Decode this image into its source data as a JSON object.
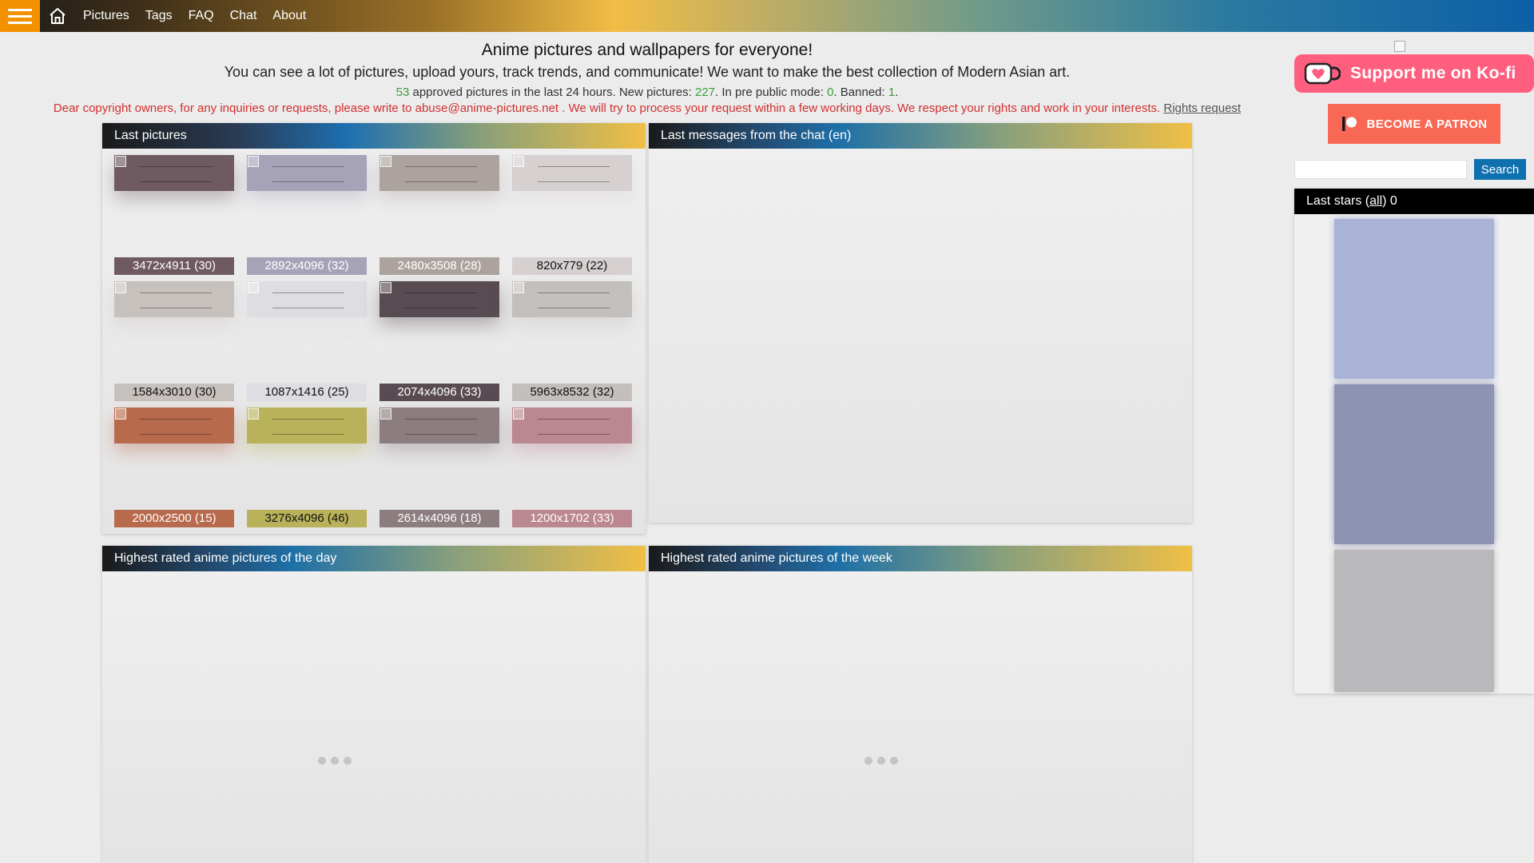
{
  "colors": {
    "accent_orange": "#f39200",
    "stat_green": "#3aa03a",
    "notice_red": "#d23030",
    "kofi_pink": "#ff5e7e",
    "patreon_coral": "#f96854",
    "search_blue": "#0f70b0"
  },
  "topbar": {
    "menu_icon": "hamburger-menu-icon",
    "home_icon": "home-icon",
    "nav": [
      "Pictures",
      "Tags",
      "FAQ",
      "Chat",
      "About"
    ]
  },
  "intro": {
    "title": "Anime pictures and wallpapers for everyone!",
    "subtitle": "You can see a lot of pictures, upload yours, track trends, and communicate! We want to make the best collection of Modern Asian art.",
    "stats": {
      "approved_count": "53",
      "approved_text": " approved pictures in the last 24 hours. New pictures: ",
      "new_count": "227",
      "prepublic_text": ". In pre public mode: ",
      "prepublic_count": "0",
      "banned_text": ". Banned: ",
      "banned_count": "1",
      "end": "."
    },
    "notice": "Dear copyright owners, for any inquiries or requests, please write to abuse@anime-pictures.net . We will try to process your request within a few working days. We respect your rights and work in your interests. ",
    "rights_link": "Rights request"
  },
  "last_pictures": {
    "title": "Last pictures",
    "items": [
      {
        "label": "3472x4911 (30)",
        "color": "#6e5a60",
        "text_color": "#ffffff"
      },
      {
        "label": "2892x4096 (32)",
        "color": "#a6a3b8",
        "text_color": "#ffffff"
      },
      {
        "label": "2480x3508 (28)",
        "color": "#aca39f",
        "text_color": "#ffffff"
      },
      {
        "label": "820x779 (22)",
        "color": "#d6d0d0",
        "text_color": "#111111"
      },
      {
        "label": "1584x3010 (30)",
        "color": "#c7c1bd",
        "text_color": "#111111"
      },
      {
        "label": "1087x1416 (25)",
        "color": "#dedde2",
        "text_color": "#111111"
      },
      {
        "label": "2074x4096 (33)",
        "color": "#584c52",
        "text_color": "#ffffff"
      },
      {
        "label": "5963x8532 (32)",
        "color": "#c3bfbc",
        "text_color": "#111111"
      },
      {
        "label": "2000x2500 (15)",
        "color": "#b86a4d",
        "text_color": "#ffffff"
      },
      {
        "label": "3276x4096 (46)",
        "color": "#b9b25a",
        "text_color": "#111111"
      },
      {
        "label": "2614x4096 (18)",
        "color": "#8c7e80",
        "text_color": "#ffffff"
      },
      {
        "label": "1200x1702 (33)",
        "color": "#bb8790",
        "text_color": "#ffffff"
      }
    ]
  },
  "chat": {
    "title": "Last messages from the chat (en)"
  },
  "top_day": {
    "title": "Highest rated anime pictures of the day"
  },
  "top_week": {
    "title": "Highest rated anime pictures of the week"
  },
  "sidebar": {
    "kofi_label": "Support me on Ko-fi",
    "patreon_label": "BECOME A PATRON",
    "search_value": "",
    "search_button": "Search",
    "stars_prefix": "Last stars (",
    "stars_link": "all",
    "stars_suffix": ") 0",
    "star_colors": [
      "#a9b3d6",
      "#8d93b2",
      "#b9b9bb"
    ]
  }
}
